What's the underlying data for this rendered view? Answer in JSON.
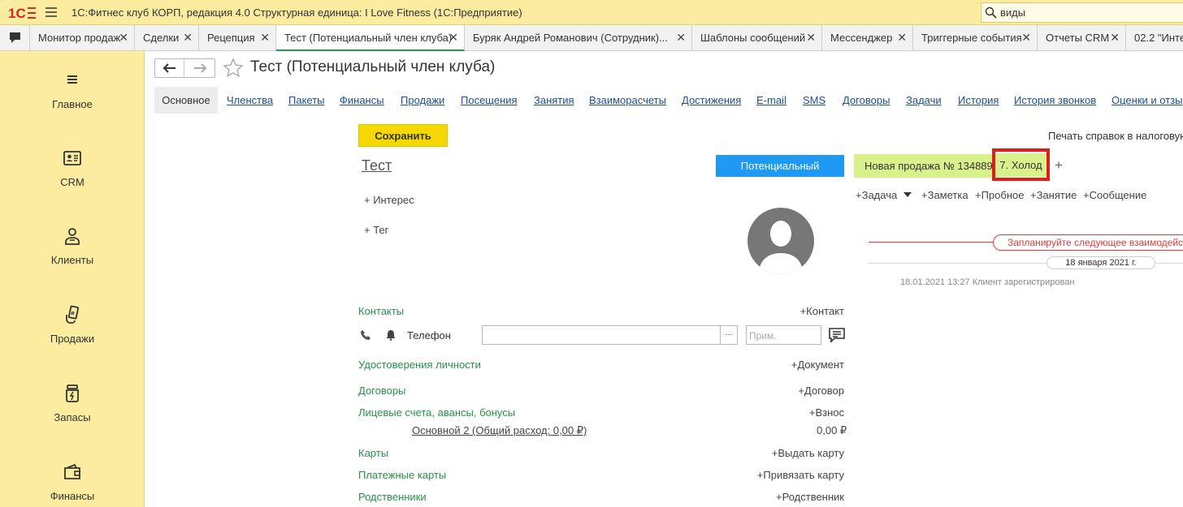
{
  "titlebar": {
    "app_title": "1С:Фитнес клуб КОРП, редакция 4.0 Структурная единица: I Love Fitness  (1С:Предприятие)",
    "search_value": "виды"
  },
  "tabs": [
    {
      "label": "Монитор продаж"
    },
    {
      "label": "Сделки"
    },
    {
      "label": "Рецепция"
    },
    {
      "label": "Тест (Потенциальный член клуба)"
    },
    {
      "label": "Буряк Андрей Романович (Сотрудник)..."
    },
    {
      "label": "Шаблоны сообщений"
    },
    {
      "label": "Мессенджер"
    },
    {
      "label": "Триггерные события"
    },
    {
      "label": "Отчеты CRM"
    },
    {
      "label": "02.2 \"Инте"
    }
  ],
  "tab_close": "✕",
  "sidebar": {
    "items": [
      {
        "label": "Главное",
        "icon": "menu-icon"
      },
      {
        "label": "CRM",
        "icon": "contact-card-icon"
      },
      {
        "label": "Клиенты",
        "icon": "person-icon"
      },
      {
        "label": "Продажи",
        "icon": "hand-card-icon"
      },
      {
        "label": "Запасы",
        "icon": "jar-icon"
      },
      {
        "label": "Финансы",
        "icon": "wallet-icon"
      }
    ]
  },
  "form": {
    "title": "Тест (Потенциальный член клуба)",
    "sections": [
      "Основное",
      "Членства",
      "Пакеты",
      "Финансы",
      "Продажи",
      "Посещения",
      "Занятия",
      "Взаиморасчеты",
      "Достижения",
      "E-mail",
      "SMS",
      "Договоры",
      "Задачи",
      "История",
      "История звонков",
      "Оценки и отзы"
    ],
    "save_label": "Сохранить",
    "name": "Тест",
    "status": "Потенциальный",
    "interest_link": "+ Интерес",
    "tag_link": "+ Тег",
    "contacts_label": "Контакты",
    "add_contact": "+Контакт",
    "phone_label": "Телефон",
    "phone_value": "",
    "select_dots": "...",
    "note_placeholder": "Прим.",
    "id_docs_label": "Удостоверения личности",
    "add_document": "+Документ",
    "contracts_label": "Договоры",
    "add_contract": "+Договор",
    "accounts_label": "Лицевые счета, авансы, бонусы",
    "add_deposit": "+Взнос",
    "account_line": "Основной 2 (Общий расход: 0,00 ₽)",
    "account_value": "0,00 ₽",
    "cards_label": "Карты",
    "issue_card": "+Выдать карту",
    "payment_cards_label": "Платежные карты",
    "link_card": "+Привязать карту",
    "relatives_label": "Родственники",
    "add_relative": "+Родственник"
  },
  "right_panel": {
    "print_link": "Печать справок в налоговую",
    "sale_tag": "Новая продажа № 134889",
    "stage": "7. Холод",
    "add_stage": "+",
    "actions": [
      "+Задача",
      "+Заметка",
      "+Пробное",
      "+Занятие",
      "+Сообщение"
    ],
    "plan_text": "Запланируйте следующее взаимодействие",
    "date_label": "18 января 2021 г.",
    "event": "18.01.2021 13:27 Клиент зарегистрирован"
  },
  "colors": {
    "chrome_yellow": "#fbeca0",
    "save_yellow": "#f5d800",
    "status_blue": "#1e9af5",
    "stage_green": "#daf08a",
    "highlight_red": "#e21b1b",
    "label_green": "#27914a",
    "link_blue": "#1b4e9b"
  }
}
